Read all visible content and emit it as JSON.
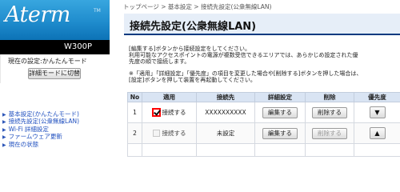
{
  "brand": {
    "logo": "Aterm",
    "trademark": "TM",
    "model": "W300P"
  },
  "mode": {
    "current_label": "現在の設定:かんたんモード",
    "switch_button": "詳細モードに切替"
  },
  "nav": {
    "items": [
      {
        "label": "基本設定(かんたんモード)"
      },
      {
        "label": "接続先設定(公衆無線LAN)"
      },
      {
        "label": "Wi-Fi 詳細設定"
      },
      {
        "label": "ファームウェア更新"
      },
      {
        "label": "現在の状態"
      }
    ]
  },
  "breadcrumb": "トップページ > 基本設定 > 接続先設定(公衆無線LAN)",
  "page_title": "接続先設定(公衆無線LAN)",
  "description": {
    "line1": "[編集する]ボタンから接続設定をしてください。",
    "line2": "利用可能なアクセスポイントの電源が複数受信できるエリアでは、あらかじめ設定された優",
    "line3": "先度の順で接続します。",
    "line4": "※「適用」「詳細設定」「優先度」の項目を変更した場合や[削除する]ボタンを押した場合は、",
    "line5": "[設定]ボタンを押して装置を再起動してください。"
  },
  "table": {
    "headers": {
      "no": "No",
      "apply": "適用",
      "dest": "接続先",
      "detail": "詳細設定",
      "delete": "削除",
      "priority": "優先度"
    },
    "rows": [
      {
        "no": "1",
        "apply_label": "接続する",
        "checked": true,
        "dest": "XXXXXXXXXX",
        "edit": "編集する",
        "delete": "削除する",
        "up": "▲",
        "down": "▼"
      },
      {
        "no": "2",
        "apply_label": "接続する",
        "checked": false,
        "dest": "未設定",
        "edit": "編集する",
        "delete": "削除する",
        "up": "▲",
        "down": "▼"
      }
    ]
  },
  "colors": {
    "brand_blue": "#1f8ccd",
    "title_bg": "#e6eef8",
    "title_underline": "#003a80",
    "header_bg": "#d9e4f3",
    "checkbox_highlight": "#ff0000",
    "link": "#1f4fbf"
  }
}
